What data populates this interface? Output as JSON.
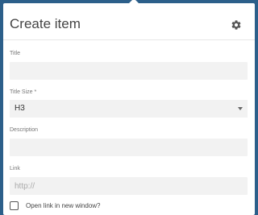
{
  "header": {
    "title": "Create item",
    "settings_icon": "gear-icon"
  },
  "form": {
    "title_label": "Title",
    "title_value": "",
    "title_size_label": "Title Size *",
    "title_size_value": "H3",
    "description_label": "Description",
    "description_value": "",
    "link_label": "Link",
    "link_value": "",
    "link_placeholder": "http://",
    "new_window_label": "Open link in new window?",
    "new_window_checked": false
  },
  "colors": {
    "background": "#2c5f8a",
    "panel": "#ffffff",
    "field": "#f2f2f2"
  }
}
